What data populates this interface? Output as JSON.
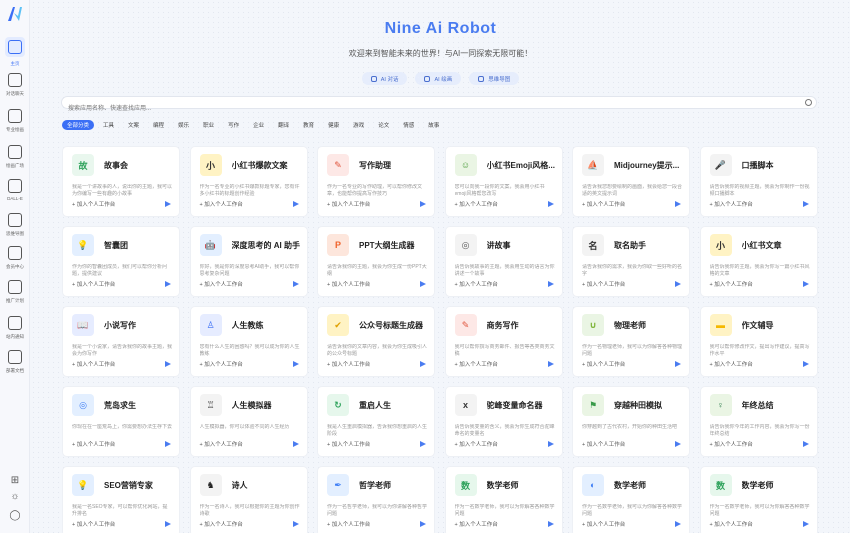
{
  "sidebar": {
    "items": [
      {
        "label": "主页",
        "active": true
      },
      {
        "label": "对话聊天"
      },
      {
        "label": "专业绘画"
      },
      {
        "label": "绘画广场"
      },
      {
        "label": "DALL-E"
      },
      {
        "label": "思维导图"
      },
      {
        "label": "会员中心"
      },
      {
        "label": "推广计划"
      },
      {
        "label": "站内通知"
      },
      {
        "label": "部署文档"
      }
    ]
  },
  "header": {
    "title": "Nine Ai Robot",
    "subtitle": "欢迎来到智能未来的世界！与AI一同探索无限可能！",
    "pills": [
      "AI 对话",
      "AI 绘画",
      "思维导图"
    ]
  },
  "search": {
    "placeholder": "搜索应用名称、快速查找应用..."
  },
  "categories": [
    "全部分类",
    "工具",
    "文案",
    "编程",
    "娱乐",
    "职业",
    "写作",
    "企业",
    "翻译",
    "教育",
    "健康",
    "游戏",
    "论文",
    "情感",
    "故事"
  ],
  "add_label": "加入个人工作台",
  "colors": {
    "accent": "#3b6ff5",
    "title": "#4a7cf0"
  },
  "cards": [
    {
      "name": "故事会",
      "desc": "我是一个讲故事的人，说出你的主题，我可以为你编写一些有趣的小故事"
    },
    {
      "name": "小红书爆款文案",
      "desc": "作为一名专业的小红书爆款标题专家，您有许多小红书的标题创作经验"
    },
    {
      "name": "写作助理",
      "desc": "作为一名专业的写作助理，可以帮你修改文章，也能帮你提高写作技巧"
    },
    {
      "name": "小红书Emoji风格...",
      "desc": "您可以向我一段你的文案，我会用小红书emoji风格帮您改写"
    },
    {
      "name": "Midjourney提示...",
      "desc": "请告诉我您想要绘制的画面，我会给您一段合适的英文提示词"
    },
    {
      "name": "口播脚本",
      "desc": "请告诉我你的视频主题，我会为你制作一份视频口播脚本"
    },
    {
      "name": "智囊团",
      "desc": "作为你的智囊团成员，我们可以帮你分析问题，提供建议"
    },
    {
      "name": "深度思考的 AI 助手",
      "desc": "你好，我是你的深度思考AI助手，我可以帮你思考复杂问题"
    },
    {
      "name": "PPT大纲生成器",
      "desc": "请告诉我你的主题，我会为你生成一份PPT大纲"
    },
    {
      "name": "讲故事",
      "desc": "请告诉我故事的主题，我会用生动的语言为你讲述一个故事"
    },
    {
      "name": "取名助手",
      "desc": "请告诉我你的需求，我会为你取一些好听的名字"
    },
    {
      "name": "小红书文章",
      "desc": "请告诉我你的主题，我会为你写一篇小红书风格的文章"
    },
    {
      "name": "小说写作",
      "desc": "我是一个小说家，请告诉我你的故事主题，我会为你写作"
    },
    {
      "name": "人生教练",
      "desc": "您有什么人生的困惑吗？我可以成为你的人生教练"
    },
    {
      "name": "公众号标题生成器",
      "desc": "请告诉我你的文章内容，我会为你生成吸引人的公众号标题"
    },
    {
      "name": "商务写作",
      "desc": "我可以帮你撰写商务邮件、报告等各类商务文稿"
    },
    {
      "name": "物理老师",
      "desc": "作为一名物理老师，我可以为你解答各种物理问题"
    },
    {
      "name": "作文辅导",
      "desc": "我可以帮你修改作文，提出写作建议，提高写作水平"
    },
    {
      "name": "荒岛求生",
      "desc": "你现在在一座荒岛上，你需要想办法生存下去"
    },
    {
      "name": "人生模拟器",
      "desc": "人生模拟器，你可以体验不同的人生经历"
    },
    {
      "name": "重启人生",
      "desc": "我是人生重启模拟器，告诉我你想重启的人生阶段"
    },
    {
      "name": "驼峰变量命名器",
      "desc": "请告诉我变量的含义，我会为你生成符合驼峰命名的变量名"
    },
    {
      "name": "穿越种田模拟",
      "desc": "你穿越到了古代农村，开始你的种田生活吧"
    },
    {
      "name": "年终总结",
      "desc": "请告诉我你今年的工作内容，我会为你写一份年终总结"
    },
    {
      "name": "SEO营销专家",
      "desc": "我是一名SEO专家，可以帮你优化网站，提升排名"
    },
    {
      "name": "诗人",
      "desc": "作为一名诗人，我可以根据你的主题为你创作诗歌"
    },
    {
      "name": "哲学老师",
      "desc": "作为一名哲学老师，我可以为你讲解各种哲学问题"
    },
    {
      "name": "数学老师",
      "desc": "作为一名数学老师，我可以为你解答各种数学问题"
    },
    {
      "name": "数学老师",
      "desc": "作为一名数学老师，我可以为你解答各种数学问题"
    },
    {
      "name": "数学老师",
      "desc": "作为一名数学老师，我可以为你解答各种数学问题"
    }
  ]
}
